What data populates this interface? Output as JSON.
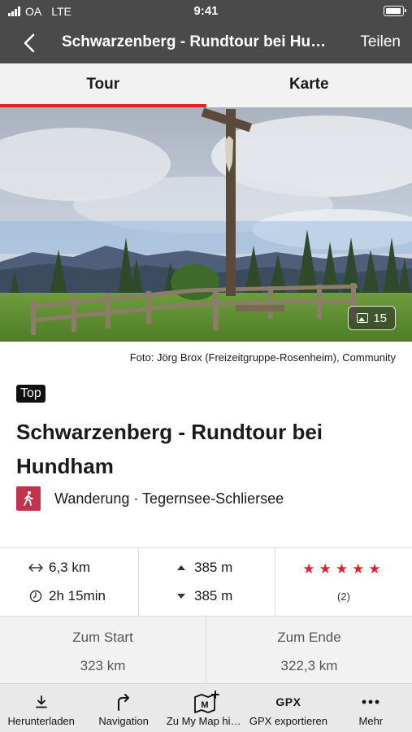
{
  "status_bar": {
    "carrier": "OA",
    "network": "LTE",
    "time": "9:41"
  },
  "nav": {
    "title": "Schwarzenberg - Rundtour bei Hundham",
    "share_label": "Teilen"
  },
  "tabs": [
    {
      "label": "Tour",
      "active": true
    },
    {
      "label": "Karte",
      "active": false
    }
  ],
  "photo": {
    "count": "15",
    "credit": "Foto: Jörg Brox (Freizeitgruppe-Rosenheim), Community"
  },
  "tour": {
    "badge": "Top",
    "title": "Schwarzenberg - Rundtour bei Hundham",
    "category": "Wanderung · Tegernsee-Schliersee",
    "category_color": "#c0334a"
  },
  "stats": {
    "distance": "6,3 km",
    "duration": "2h 15min",
    "ascent": "385 m",
    "descent": "385 m",
    "rating_stars": 5,
    "rating_count": "(2)"
  },
  "distance": {
    "to_start_label": "Zum Start",
    "to_start_value": "323 km",
    "to_end_label": "Zum Ende",
    "to_end_value": "322,3 km"
  },
  "toolbar": {
    "download": "Herunterladen",
    "navigation": "Navigation",
    "mymap": "Zu My Map hinzufügen",
    "gpx_icon": "GPX",
    "gpx": "GPX exportieren",
    "more": "Mehr"
  },
  "colors": {
    "accent": "#e3202e",
    "bar": "#4a4a4a"
  }
}
